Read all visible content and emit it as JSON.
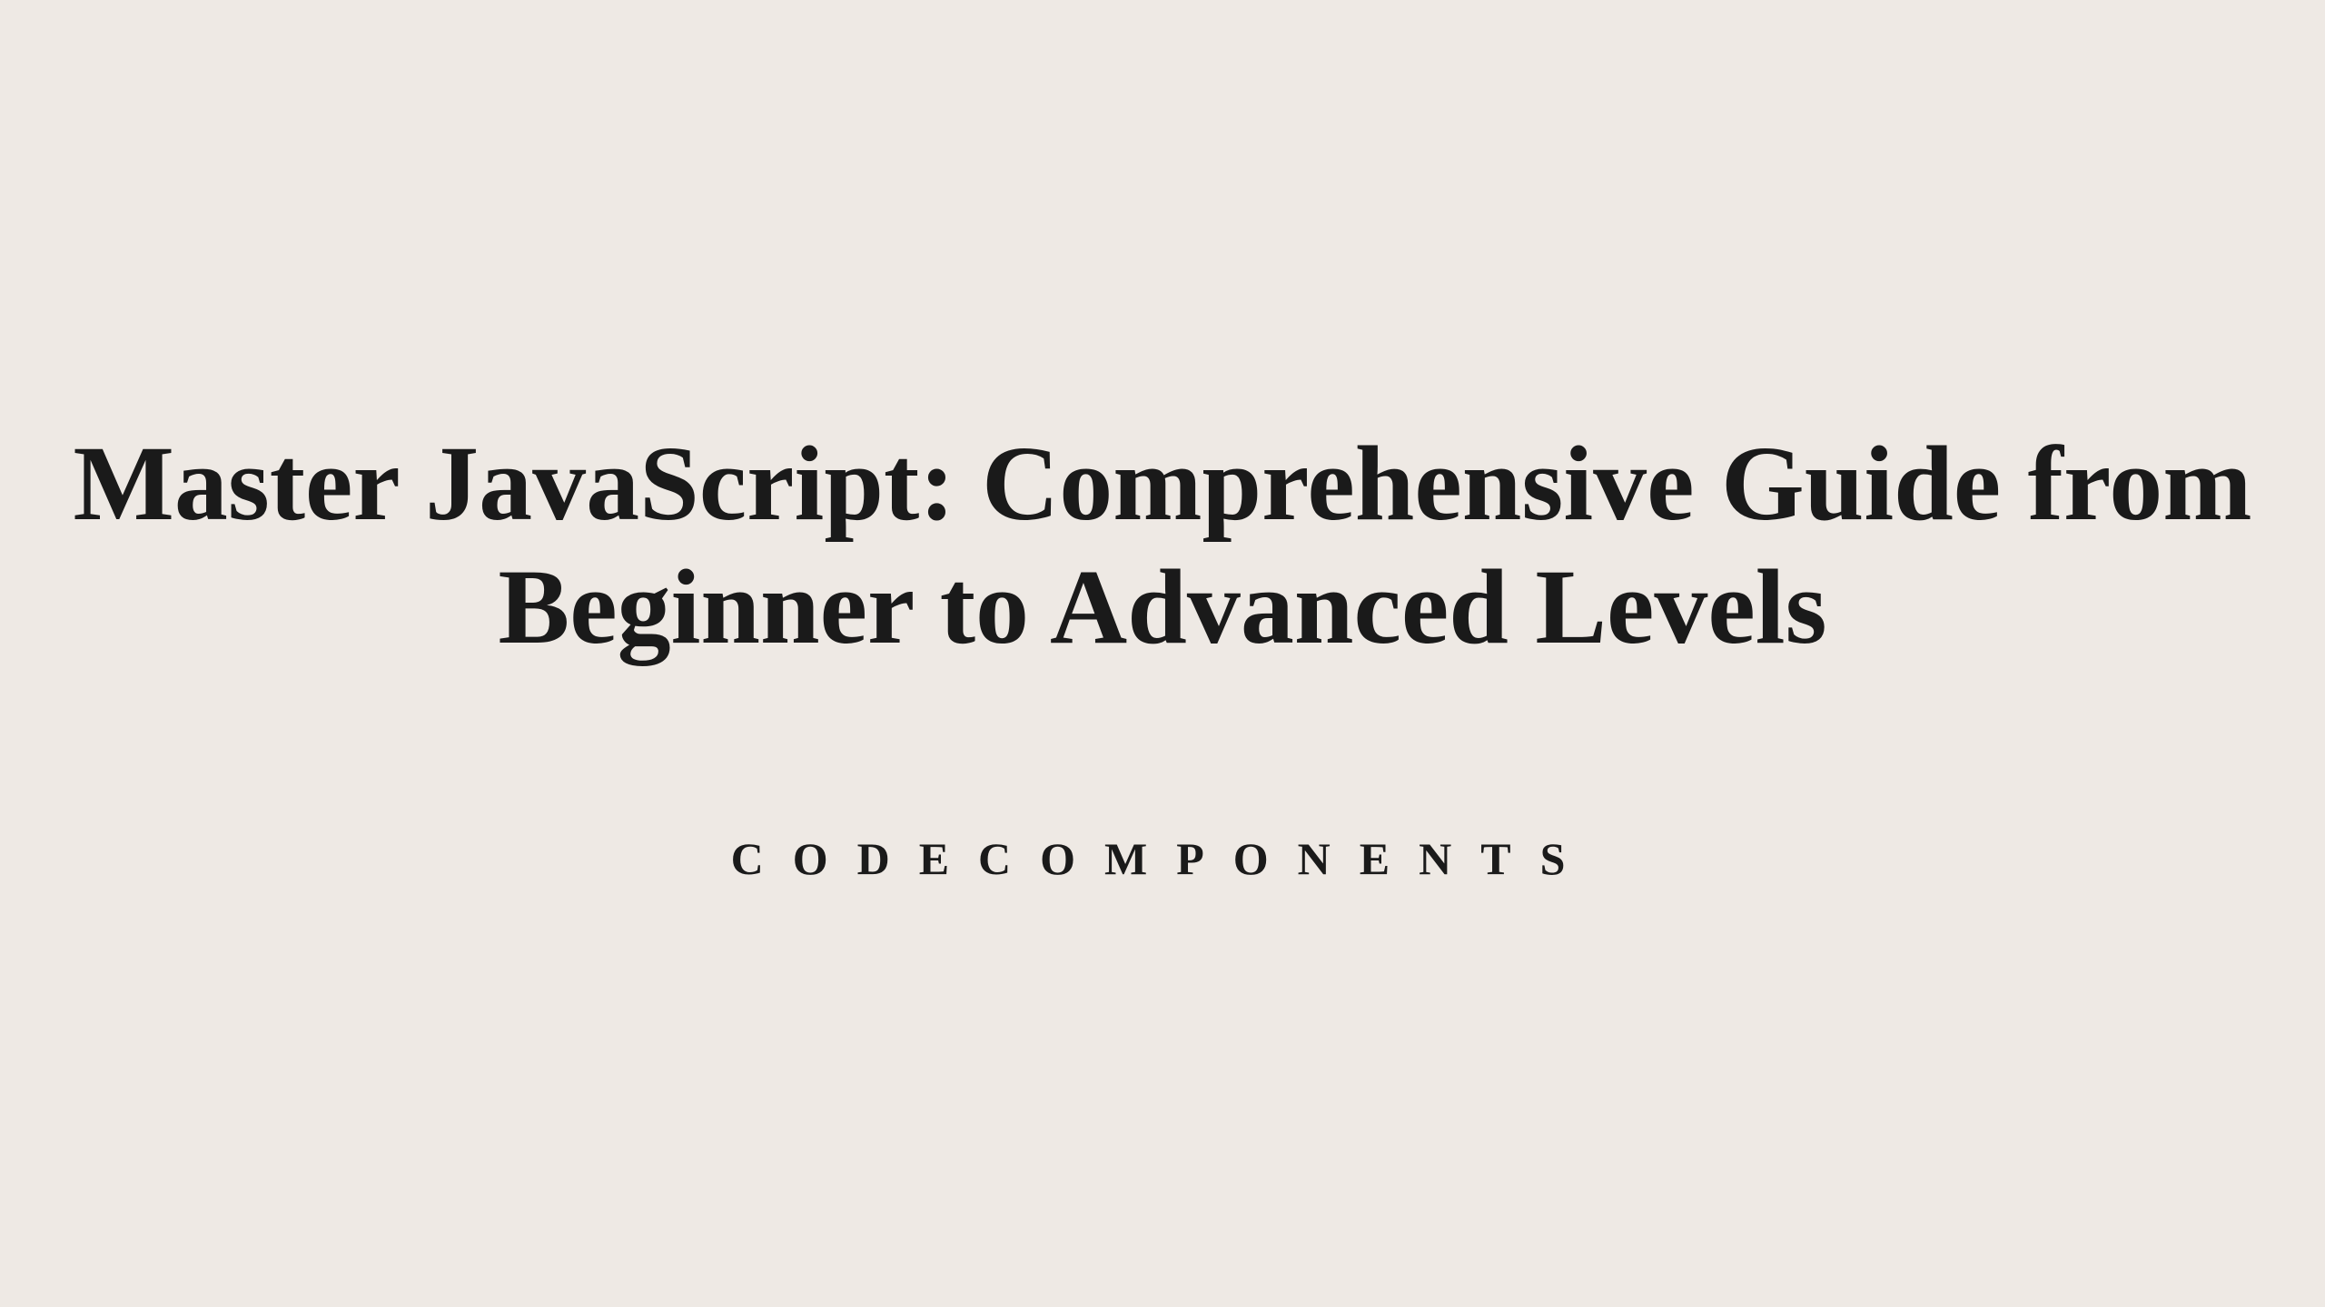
{
  "title": "Master JavaScript: Comprehensive Guide from Beginner to Advanced Levels",
  "subtitle": "CODECOMPONENTS"
}
